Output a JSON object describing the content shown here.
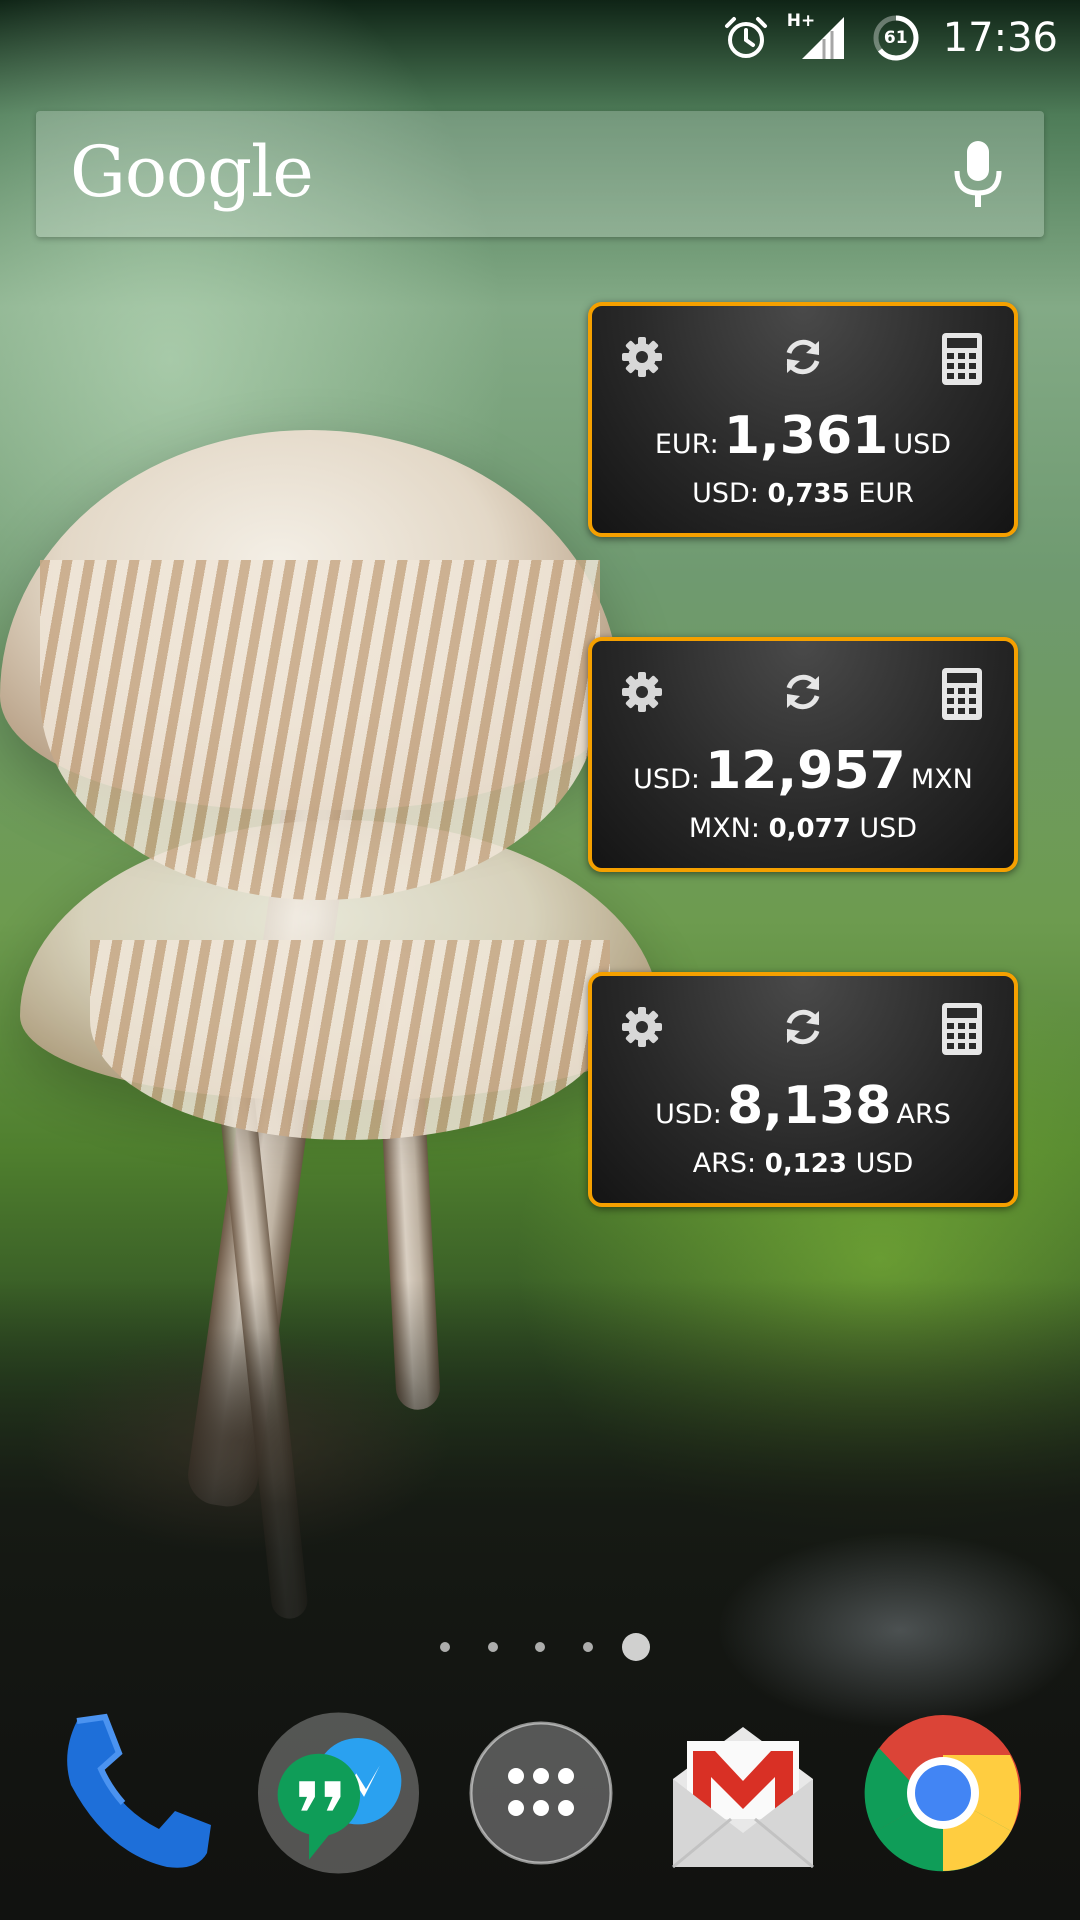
{
  "status_bar": {
    "time": "17:36",
    "network": "H+",
    "battery": "61"
  },
  "search": {
    "logo": "Google"
  },
  "widgets": [
    {
      "base": "EUR:",
      "rate": "1,361",
      "quote": "USD",
      "inv_base": "USD:",
      "inv_rate": "0,735",
      "inv_quote": "EUR"
    },
    {
      "base": "USD:",
      "rate": "12,957",
      "quote": "MXN",
      "inv_base": "MXN:",
      "inv_rate": "0,077",
      "inv_quote": "USD"
    },
    {
      "base": "USD:",
      "rate": "8,138",
      "quote": "ARS",
      "inv_base": "ARS:",
      "inv_rate": "0,123",
      "inv_quote": "USD"
    }
  ],
  "page_indicator": {
    "count": 5,
    "active": 5
  },
  "dock": [
    {
      "icon": "phone-icon"
    },
    {
      "icon": "hangouts-messenger-folder-icon"
    },
    {
      "icon": "app-drawer-icon"
    },
    {
      "icon": "gmail-icon"
    },
    {
      "icon": "chrome-icon"
    }
  ],
  "colors": {
    "widget_border": "#f5a000",
    "gmail_red": "#d93025",
    "hangouts_green": "#0f9d58",
    "phone_blue": "#1e6fd9"
  }
}
